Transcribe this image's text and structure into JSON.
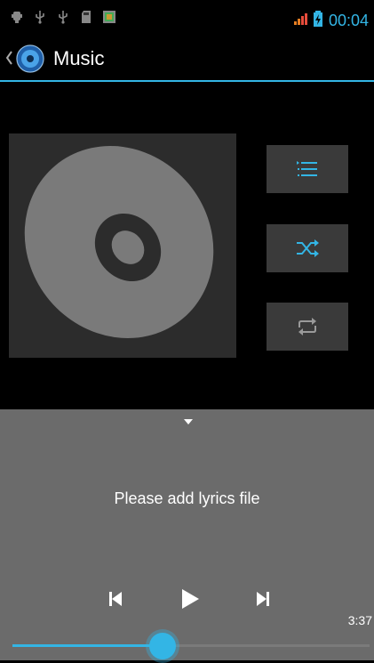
{
  "status_bar": {
    "time": "00:04",
    "icons": [
      "usb-debug-icon",
      "usb-icon",
      "usb-icon",
      "sd-card-icon",
      "gallery-icon"
    ],
    "signal_icon": "signal-icon",
    "battery_icon": "battery-charging-icon"
  },
  "action_bar": {
    "title": "Music",
    "app_icon": "music-app-icon",
    "accent": "#33b5e5"
  },
  "side_controls": [
    {
      "name": "playlist-button",
      "icon": "playlist-icon"
    },
    {
      "name": "shuffle-button",
      "icon": "shuffle-icon"
    },
    {
      "name": "repeat-button",
      "icon": "repeat-icon"
    }
  ],
  "lyrics": {
    "message": "Please add lyrics file"
  },
  "playback": {
    "duration": "3:37",
    "progress": 0.42,
    "controls": [
      "previous-icon",
      "play-icon",
      "next-icon"
    ]
  }
}
